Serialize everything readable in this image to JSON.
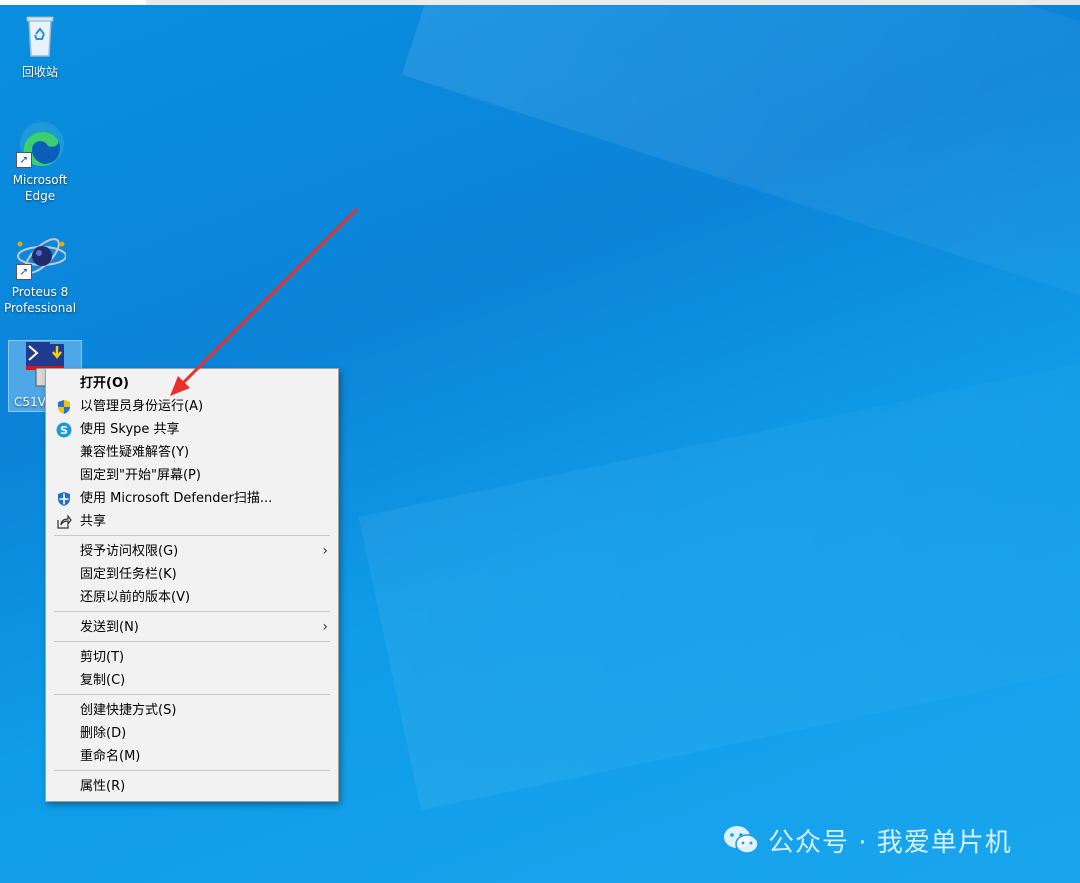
{
  "desktop": {
    "icons": [
      {
        "label": "回收站",
        "icon": "recycle-bin-icon"
      },
      {
        "label": "Microsoft Edge",
        "icon": "edge-icon"
      },
      {
        "label": "Proteus 8 Professional",
        "icon": "proteus-icon"
      },
      {
        "label": "C51V",
        "icon": "c51-app-icon"
      }
    ]
  },
  "context_menu": {
    "items": [
      {
        "label": "打开(O)",
        "bold": true
      },
      {
        "label": "以管理员身份运行(A)",
        "icon": "uac-shield-icon"
      },
      {
        "label": "使用 Skype 共享",
        "icon": "skype-icon"
      },
      {
        "label": "兼容性疑难解答(Y)"
      },
      {
        "label": "固定到\"开始\"屏幕(P)"
      },
      {
        "label": "使用 Microsoft Defender扫描...",
        "icon": "defender-icon"
      },
      {
        "label": "共享",
        "icon": "share-icon"
      },
      {
        "label": "授予访问权限(G)",
        "submenu": true
      },
      {
        "label": "固定到任务栏(K)"
      },
      {
        "label": "还原以前的版本(V)"
      },
      {
        "label": "发送到(N)",
        "submenu": true
      },
      {
        "label": "剪切(T)"
      },
      {
        "label": "复制(C)"
      },
      {
        "label": "创建快捷方式(S)"
      },
      {
        "label": "删除(D)"
      },
      {
        "label": "重命名(M)"
      },
      {
        "label": "属性(R)"
      }
    ],
    "submenu_glyph": "›"
  },
  "annotation": {
    "arrow_color": "#e8312a"
  },
  "watermark": {
    "text": "公众号 · 我爱单片机",
    "icon": "wechat-icon"
  },
  "colors": {
    "desktop_blue": "#0b88dc",
    "menu_bg": "#f2f2f2",
    "accent": "#0078d7"
  }
}
